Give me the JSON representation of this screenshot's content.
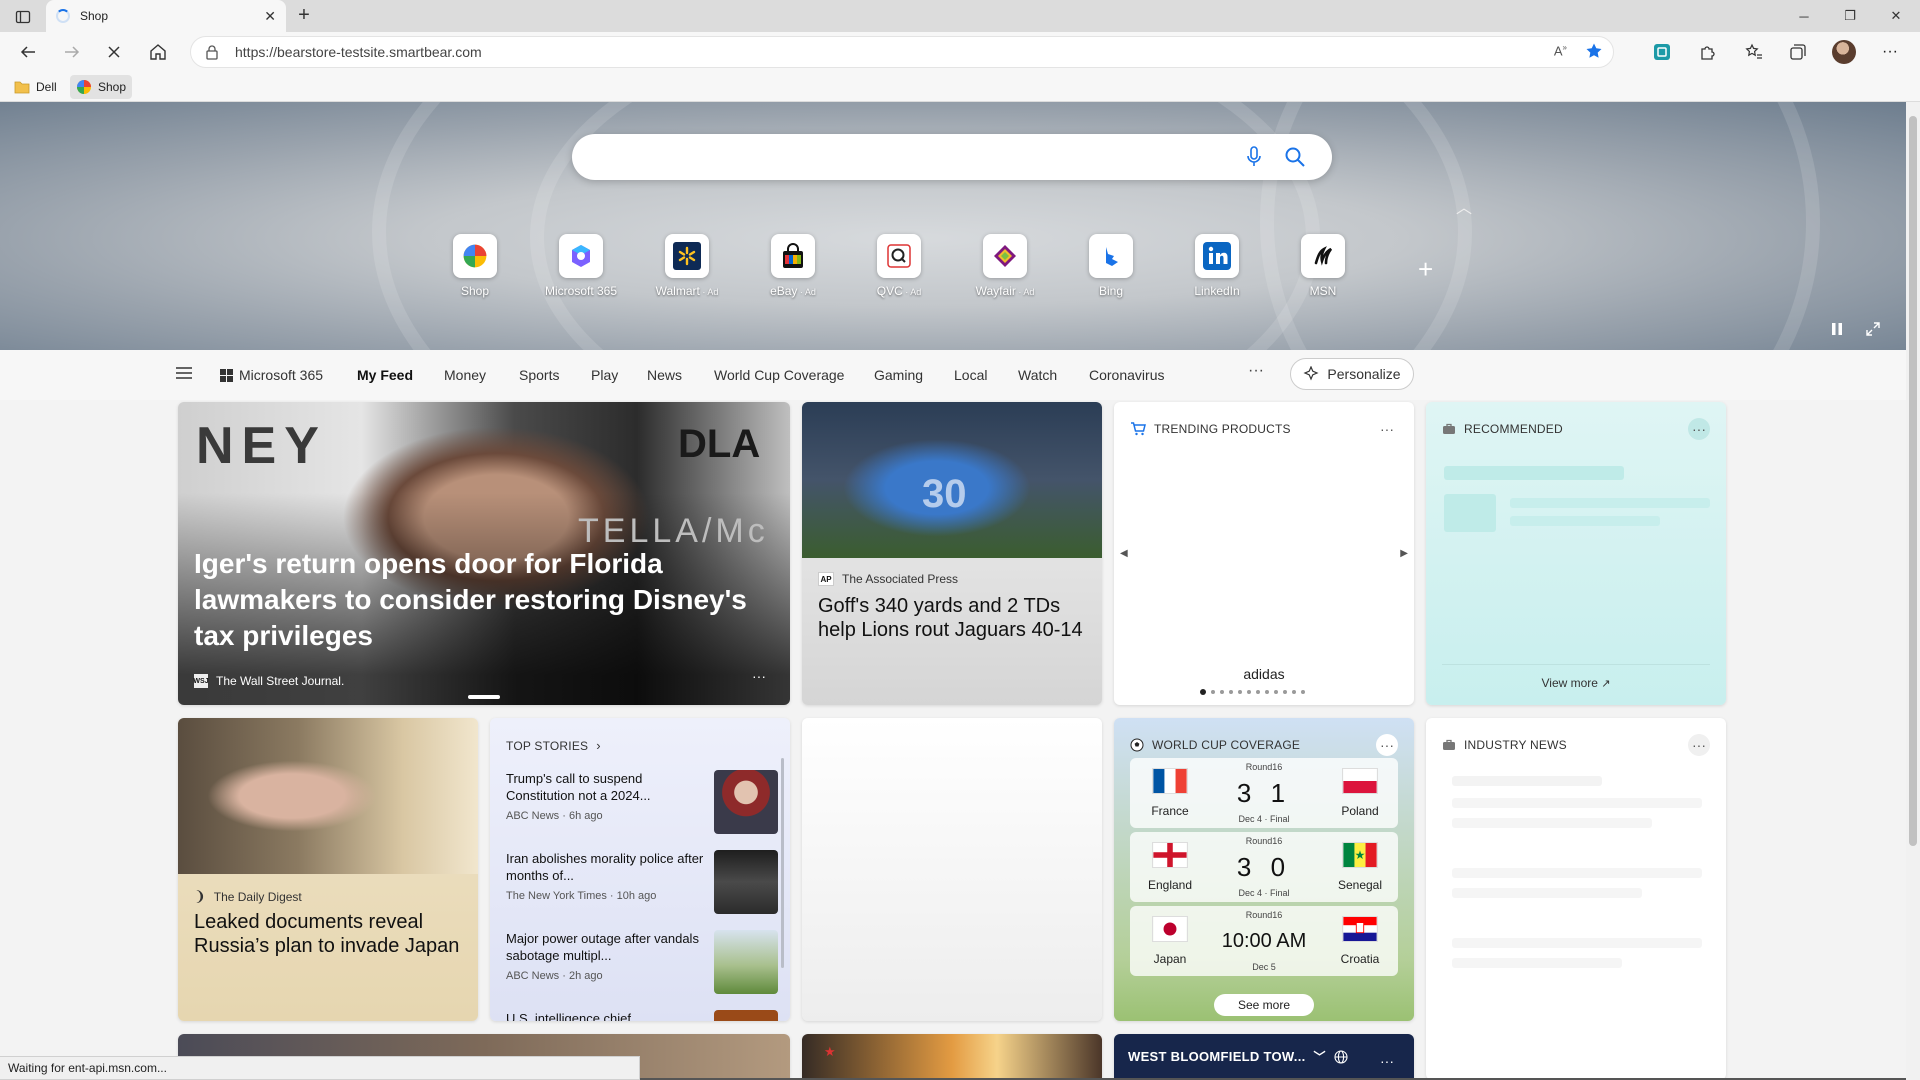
{
  "browser": {
    "tab": {
      "title": "Shop",
      "close": "✕"
    },
    "new_tab": "+",
    "window": {
      "minimize": "─",
      "restore": "❐",
      "close": "✕"
    },
    "address": "https://bearstore-testsite.smartbear.com",
    "favorites": [
      {
        "label": "Dell",
        "icon": "folder-icon"
      },
      {
        "label": "Shop",
        "icon": "shop-icon"
      }
    ],
    "more": "···"
  },
  "colors": {
    "accent": "#1a73e8",
    "nav_active": "#111111",
    "world_cup_card": "#b4cf98",
    "recommended_card": "#c8efee",
    "top_stories_card": "#dde1f4",
    "bottom_weather_card": "#17264b"
  },
  "search": {
    "value": "",
    "placeholder": ""
  },
  "quick_links": [
    {
      "label": "Shop",
      "ad": "",
      "icon": "shop-icon"
    },
    {
      "label": "Microsoft 365",
      "ad": "",
      "icon": "microsoft365-icon"
    },
    {
      "label": "Walmart",
      "ad": " · Ad",
      "icon": "walmart-icon"
    },
    {
      "label": "eBay",
      "ad": " · Ad",
      "icon": "ebay-icon"
    },
    {
      "label": "QVC",
      "ad": " · Ad",
      "icon": "qvc-icon"
    },
    {
      "label": "Wayfair",
      "ad": " · Ad",
      "icon": "wayfair-icon"
    },
    {
      "label": "Bing",
      "ad": "",
      "icon": "bing-icon"
    },
    {
      "label": "LinkedIn",
      "ad": "",
      "icon": "linkedin-icon"
    },
    {
      "label": "MSN",
      "ad": "",
      "icon": "msn-icon"
    }
  ],
  "nav": {
    "items": [
      {
        "label": "Microsoft 365",
        "active": false
      },
      {
        "label": "My Feed",
        "active": true
      },
      {
        "label": "Money",
        "active": false
      },
      {
        "label": "Sports",
        "active": false
      },
      {
        "label": "Play",
        "active": false
      },
      {
        "label": "News",
        "active": false
      },
      {
        "label": "World Cup Coverage",
        "active": false
      },
      {
        "label": "Gaming",
        "active": false
      },
      {
        "label": "Local",
        "active": false
      },
      {
        "label": "Watch",
        "active": false
      },
      {
        "label": "Coronavirus",
        "active": false
      }
    ],
    "more": "···",
    "personalize": "Personalize"
  },
  "cards": {
    "iger": {
      "headline": "Iger's return opens door for Florida lawmakers to consider restoring Disney's tax privileges",
      "source": "The Wall Street Journal.",
      "source_logo": "WSJ"
    },
    "lions": {
      "source": "The Associated Press",
      "source_logo": "AP",
      "headline": "Goff's 340 yards and 2 TDs help Lions rout Jaguars 40-14"
    },
    "trending": {
      "title": "TRENDING PRODUCTS",
      "brand": "adidas",
      "pages": 12,
      "current_page": 1
    },
    "recommended": {
      "title": "RECOMMENDED",
      "view_more": "View more"
    },
    "putin": {
      "source": "The Daily Digest",
      "headline": "Leaked documents reveal Russia’s plan to invade Japan"
    },
    "top_stories": {
      "title": "TOP STORIES",
      "stories": [
        {
          "title": "Trump's call to suspend Constitution not a 2024...",
          "meta": "ABC News · 6h ago"
        },
        {
          "title": "Iran abolishes morality police after months of...",
          "meta": "The New York Times · 10h ago"
        },
        {
          "title": "Major power outage after vandals sabotage multipl...",
          "meta": "ABC News · 2h ago"
        },
        {
          "title": "U.S. intelligence chief",
          "meta": ""
        }
      ]
    },
    "world_cup": {
      "title": "WORLD CUP COVERAGE",
      "matches": [
        {
          "round": "Round16",
          "home": "France",
          "away": "Poland",
          "score": "3 1",
          "time": "",
          "status": "Dec 4 · Final"
        },
        {
          "round": "Round16",
          "home": "England",
          "away": "Senegal",
          "score": "3 0",
          "time": "",
          "status": "Dec 4 · Final"
        },
        {
          "round": "Round16",
          "home": "Japan",
          "away": "Croatia",
          "score": "",
          "time": "10:00 AM",
          "status": "Dec 5"
        }
      ],
      "see_more": "See more"
    },
    "industry_news": {
      "title": "INDUSTRY NEWS"
    },
    "weather": {
      "title": "WEST BLOOMFIELD TOW..."
    }
  },
  "status_bar": "Waiting for ent-api.msn.com..."
}
